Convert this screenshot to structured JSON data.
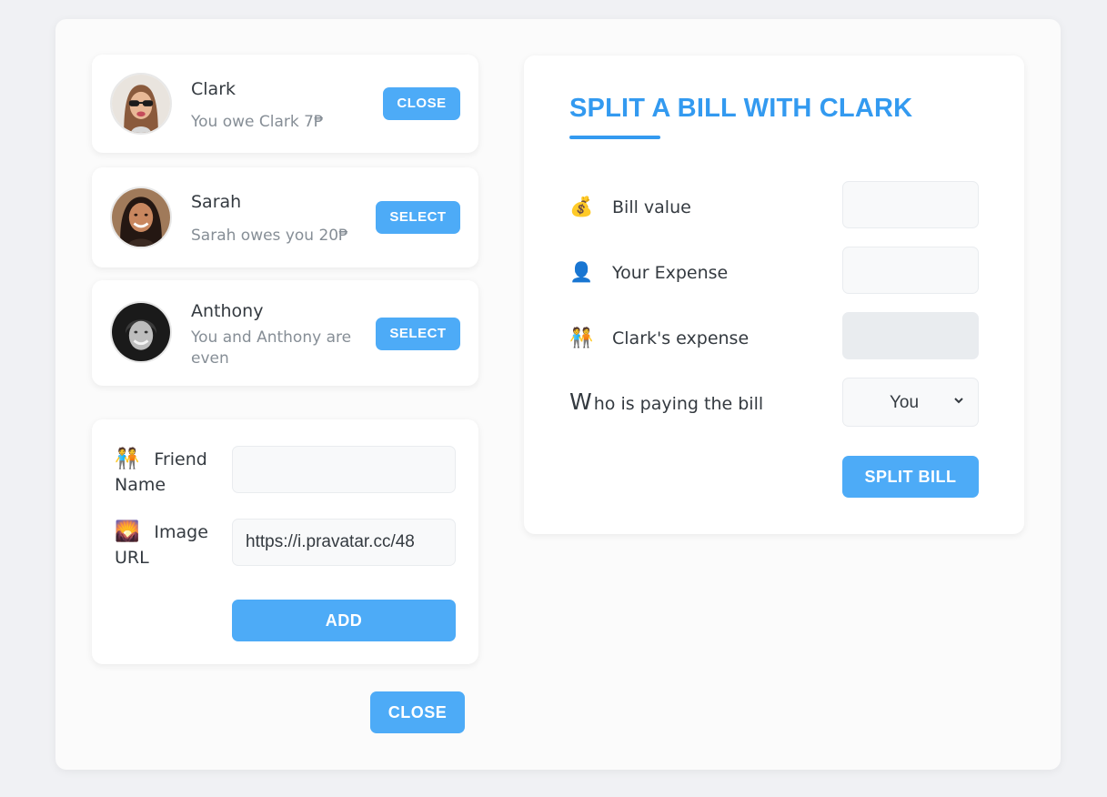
{
  "friends": [
    {
      "name": "Clark",
      "status": "You owe Clark 7₱",
      "button": "CLOSE",
      "status_color": "#868e96"
    },
    {
      "name": "Sarah",
      "status": "Sarah owes you 20₱",
      "button": "SELECT",
      "status_color": "#868e96"
    },
    {
      "name": "Anthony",
      "status": "You and Anthony are even",
      "button": "SELECT",
      "status_color": "#868e96"
    }
  ],
  "add_friend_form": {
    "name_label": "Friend Name",
    "name_icon": "people-holding-hands-icon",
    "name_value": "",
    "image_label": "Image URL",
    "image_icon": "picture-icon",
    "image_value": "https://i.pravatar.cc/48",
    "add_button": "ADD"
  },
  "close_form_button": "CLOSE",
  "split_form": {
    "title": "SPLIT A BILL WITH CLARK",
    "bill_label": "Bill value",
    "bill_icon": "money-bag-icon",
    "bill_value": "",
    "your_expense_label": "Your Expense",
    "your_expense_icon": "person-silhouette-icon",
    "your_expense_value": "",
    "friend_expense_label": "Clark's expense",
    "friend_expense_icon": "people-holding-hands-icon",
    "friend_expense_value": "",
    "payer_label_initial": "W",
    "payer_label_rest": "ho is paying the bill",
    "payer_selected": "You",
    "split_button": "SPLIT BILL"
  },
  "colors": {
    "accent": "#4dabf7",
    "title": "#339af0",
    "text": "#343a40",
    "muted": "#868e96"
  }
}
